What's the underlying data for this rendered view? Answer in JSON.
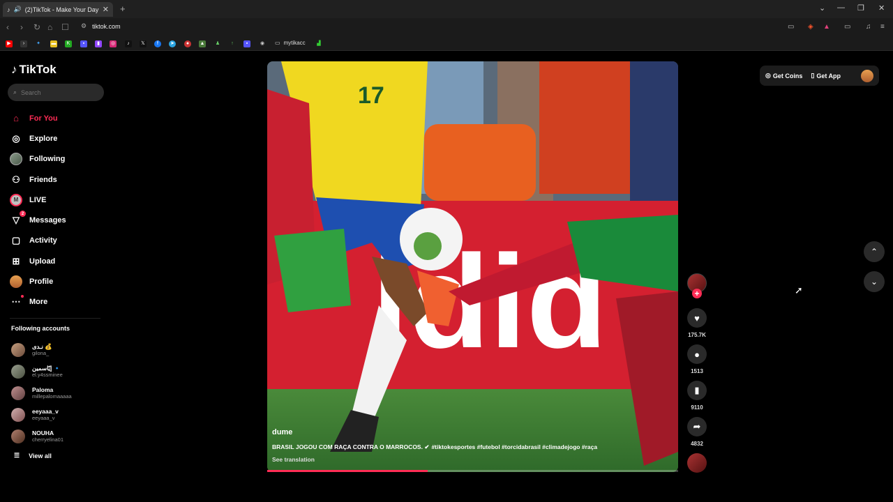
{
  "browser": {
    "tab_title": "(2)TikTok - Make Your Day",
    "url": "tiktok.com",
    "bookmark_folder": "mytikacc"
  },
  "sidebar": {
    "logo_text": "TikTok",
    "search_placeholder": "Search",
    "menu": [
      {
        "label": "For You",
        "icon": "home-icon",
        "active": true
      },
      {
        "label": "Explore",
        "icon": "compass-icon"
      },
      {
        "label": "Following",
        "icon": "avatar"
      },
      {
        "label": "Friends",
        "icon": "people-icon"
      },
      {
        "label": "LIVE",
        "icon": "live-avatar"
      },
      {
        "label": "Messages",
        "icon": "paper-plane-icon",
        "badge": "2"
      },
      {
        "label": "Activity",
        "icon": "activity-icon"
      },
      {
        "label": "Upload",
        "icon": "upload-icon"
      },
      {
        "label": "Profile",
        "icon": "profile-avatar"
      },
      {
        "label": "More",
        "icon": "more-icon"
      }
    ],
    "following_title": "Following accounts",
    "following": [
      {
        "name": "نـدى 💰",
        "handle": "gilona_"
      },
      {
        "name": "إيّاسمين 🔹",
        "handle": "el.y4ssminee"
      },
      {
        "name": "Paloma",
        "handle": "millepalomaaaaa"
      },
      {
        "name": "eeyaaa_v",
        "handle": "eeyaaa_v"
      },
      {
        "name": "NOUHA",
        "handle": "cherryelina01"
      }
    ],
    "view_all": "View all"
  },
  "video": {
    "author": "dume",
    "description": "BRASIL JOGOU COM RAÇA CONTRA O MARROCOS. ✔",
    "hashtags": "#tiktokesportes  #futebol #torcidabrasil #climadejogo #raça",
    "see_translation": "See translation",
    "progress": 0.39
  },
  "actions": {
    "likes": "175.7K",
    "comments": "1513",
    "saves": "9110",
    "shares": "4832"
  },
  "topbar": {
    "get_coins": "Get Coins",
    "get_app": "Get App"
  }
}
